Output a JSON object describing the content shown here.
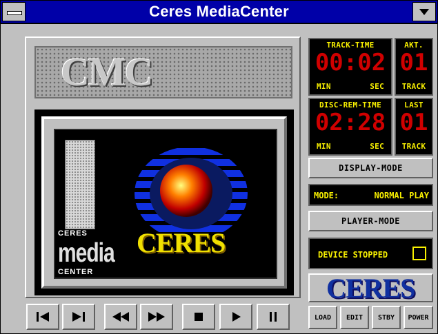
{
  "window": {
    "title": "Ceres MediaCenter"
  },
  "branding": {
    "plate_logo": "CMC",
    "screen_logo_line1": "CERES",
    "screen_logo_line2": "media",
    "screen_logo_line3": "CENTER",
    "screen_brand": "CERES",
    "panel_brand": "CERES"
  },
  "display": {
    "track_time": {
      "label": "TRACK-TIME",
      "digits": "00:02",
      "unit_left": "MIN",
      "unit_right": "SEC"
    },
    "current_track": {
      "label": "AKT.",
      "digits": "01",
      "unit": "TRACK"
    },
    "disc_remaining": {
      "label": "DISC-REM-TIME",
      "digits": "02:28",
      "unit_left": "MIN",
      "unit_right": "SEC"
    },
    "last_track": {
      "label": "LAST",
      "digits": "01",
      "unit": "TRACK"
    },
    "mode_label": "MODE:",
    "mode_value": "NORMAL PLAY",
    "device_status": "DEVICE STOPPED"
  },
  "buttons": {
    "display_mode": "DISPLAY-MODE",
    "player_mode": "PLAYER-MODE",
    "load": "LOAD",
    "edit": "EDIT",
    "stby": "STBY",
    "power": "POWER"
  },
  "transport_icons": [
    "previous-track-icon",
    "next-track-icon",
    "rewind-icon",
    "fast-forward-icon",
    "stop-icon",
    "play-icon",
    "pause-icon"
  ],
  "colors": {
    "titlebar": "#0000a8",
    "lcd_text": "#f8f000",
    "lcd_digit_red": "#d00000",
    "brand_blue": "#1030a0",
    "face": "#c0c0c0"
  }
}
